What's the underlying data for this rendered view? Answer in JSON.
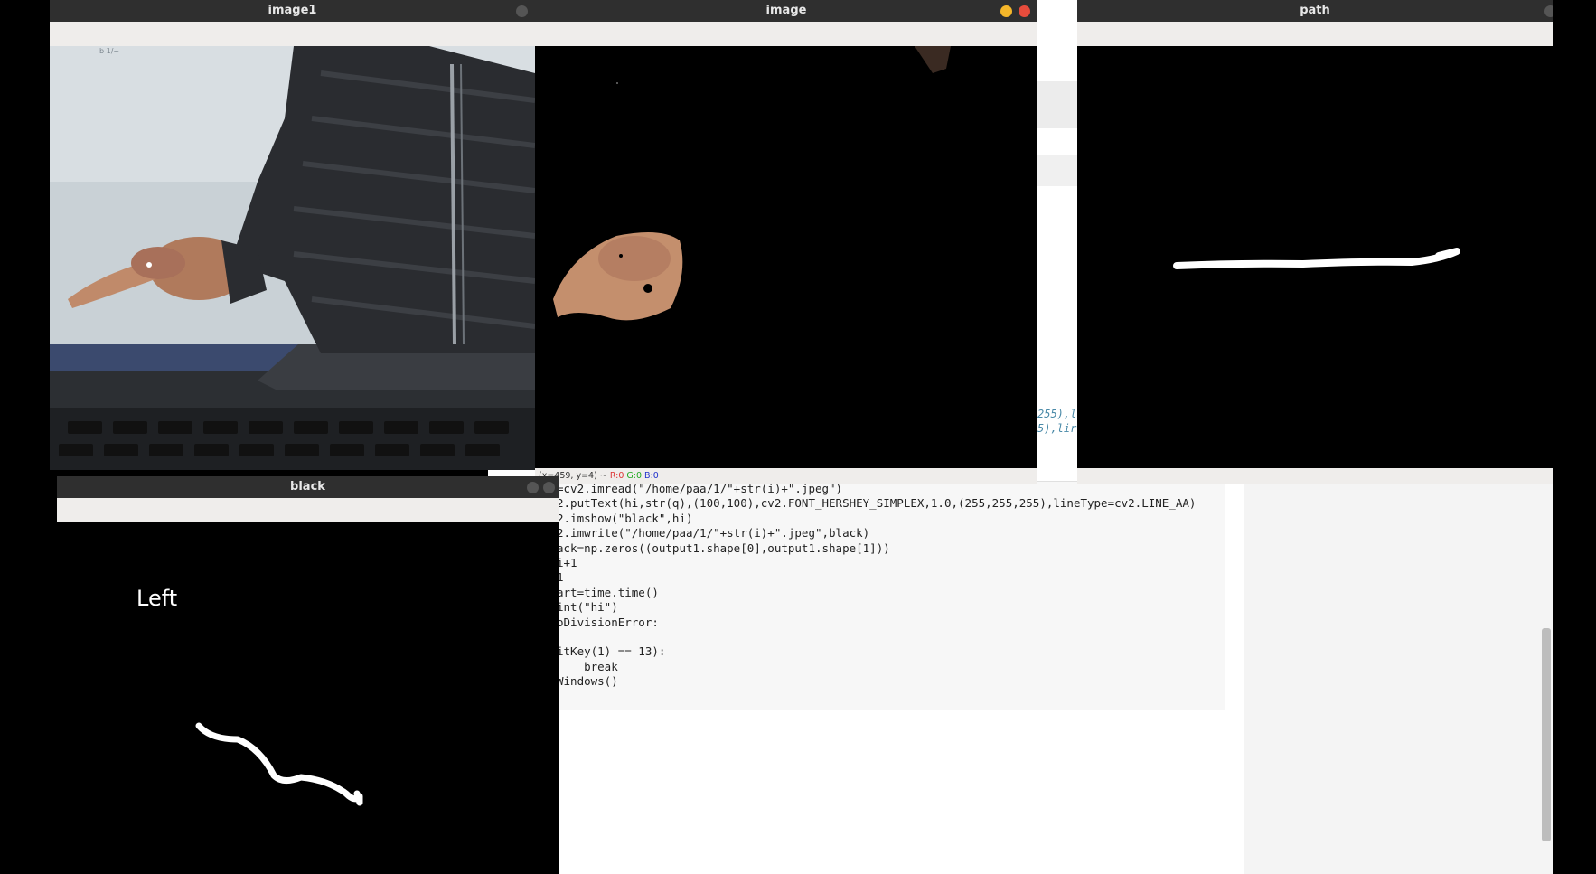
{
  "windows": {
    "image1": {
      "title": "image1"
    },
    "image": {
      "title": "image",
      "status": {
        "coords": "(x=459, y=4) ~",
        "r": "R:0",
        "g": "G:0",
        "b": "B:0"
      }
    },
    "path": {
      "title": "path"
    },
    "black": {
      "title": "black",
      "overlay_text": "Left"
    }
  },
  "editor": {
    "code_lines": [
      "=cv2.imread(\"/home/paa/1/\"+str(i)+\".jpeg\")",
      "2.putText(hi,str(q),(100,100),cv2.FONT_HERSHEY_SIMPLEX,1.0,(255,255,255),lineType=cv2.LINE_AA)",
      "2.imshow(\"black\",hi)",
      "2.imwrite(\"/home/paa/1/\"+str(i)+\".jpeg\",black)",
      "ack=np.zeros((output1.shape[0],output1.shape[1]))",
      "i+1",
      "1",
      "art=time.time()",
      "int(\"hi\")",
      "oDivisionError:",
      "",
      "itKey(1) == 13):",
      "    break",
      "Windows()"
    ],
    "fragment1": "255),l",
    "fragment2": "5),lir"
  },
  "colors": {
    "titlebar": "#2f2f2f",
    "toolbar": "#efedeb",
    "close": "#e74c3c",
    "minimize": "#f5b72a"
  }
}
